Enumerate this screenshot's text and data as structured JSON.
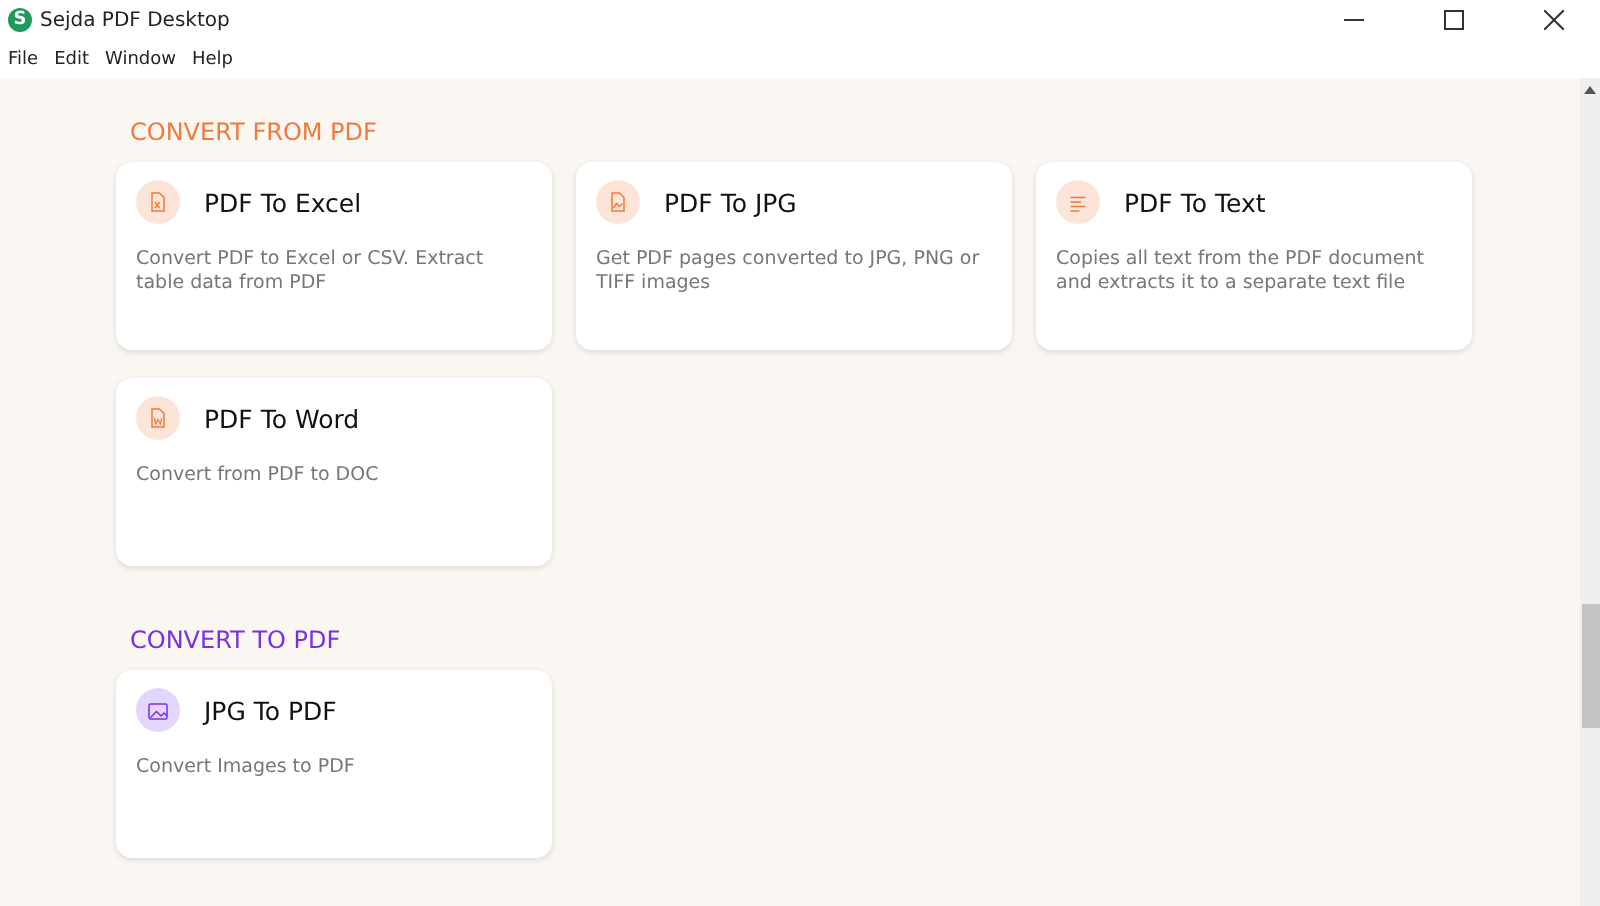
{
  "window": {
    "title": "Sejda PDF Desktop",
    "logo": "S"
  },
  "menu": [
    "File",
    "Edit",
    "Window",
    "Help"
  ],
  "sections": [
    {
      "title": "CONVERT FROM PDF",
      "color": "#f07a3a",
      "cards": [
        {
          "title": "PDF To Excel",
          "description": "Convert PDF to Excel or CSV. Extract table data from PDF",
          "kind": "excel"
        },
        {
          "title": "PDF To JPG",
          "description": "Get PDF pages converted to JPG, PNG or TIFF images",
          "kind": "image-file"
        },
        {
          "title": "PDF To Text",
          "description": "Copies all text from the PDF document and extracts it to a separate text file",
          "kind": "text"
        },
        {
          "title": "PDF To Word",
          "description": "Convert from PDF to DOC",
          "kind": "word"
        }
      ]
    },
    {
      "title": "CONVERT TO PDF",
      "color": "#7a2ee6",
      "cards": [
        {
          "title": "JPG To PDF",
          "description": "Convert Images to PDF",
          "kind": "picture"
        }
      ]
    }
  ]
}
